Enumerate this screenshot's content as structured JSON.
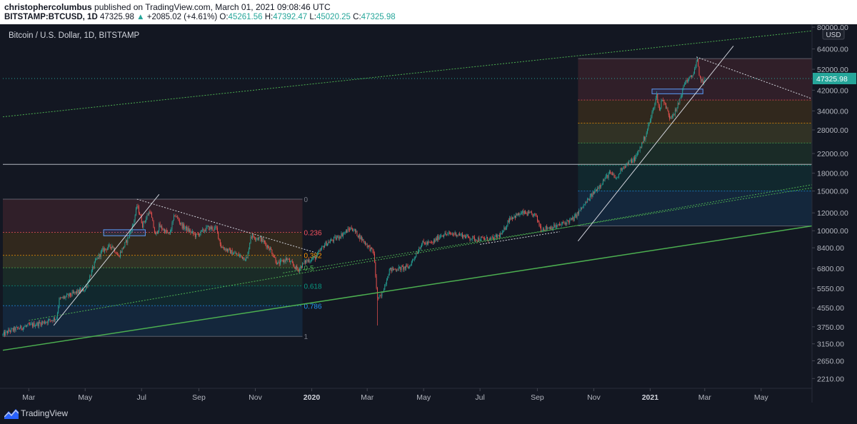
{
  "header": {
    "author": "christophercolumbus",
    "published_text": "published on TradingView.com, March 01, 2021 09:08:46 UTC",
    "symbol": "BITSTAMP:BTCUSD, 1D",
    "last": "47325.98",
    "change": "+2085.02 (+4.61%)",
    "open_label": "O:",
    "open": "45261.56",
    "high_label": "H:",
    "high": "47392.47",
    "low_label": "L:",
    "low": "45020.25",
    "close_label": "C:",
    "close": "47325.98"
  },
  "chart_data": {
    "type": "candlestick",
    "title": "Bitcoin / U.S. Dollar, 1D, BITSTAMP",
    "currency": "USD",
    "y_scale": "log",
    "ylim": [
      2000,
      80000
    ],
    "xlim": [
      "2019-02-01",
      "2021-06-25"
    ],
    "y_ticks": [
      80000,
      64000,
      52000,
      42000,
      34000,
      28000,
      22000,
      18000,
      15000,
      12000,
      10000,
      8400,
      6800,
      5550,
      4550,
      3750,
      3150,
      2650,
      2210
    ],
    "y_tick_labels": [
      "80000.00",
      "64000.00",
      "52000.00",
      "42000.00",
      "34000.00",
      "28000.00",
      "22000.00",
      "18000.00",
      "15000.00",
      "12000.00",
      "10000.00",
      "8400.00",
      "6800.00",
      "5550.00",
      "4550.00",
      "3750.00",
      "3150.00",
      "2650.00",
      "2210.00"
    ],
    "x_ticks": [
      {
        "date": "2019-03-01",
        "label": "Mar"
      },
      {
        "date": "2019-05-01",
        "label": "May"
      },
      {
        "date": "2019-07-01",
        "label": "Jul"
      },
      {
        "date": "2019-09-01",
        "label": "Sep"
      },
      {
        "date": "2019-11-01",
        "label": "Nov"
      },
      {
        "date": "2020-01-01",
        "label": "2020"
      },
      {
        "date": "2020-03-01",
        "label": "Mar"
      },
      {
        "date": "2020-05-01",
        "label": "May"
      },
      {
        "date": "2020-07-01",
        "label": "Jul"
      },
      {
        "date": "2020-09-01",
        "label": "Sep"
      },
      {
        "date": "2020-11-01",
        "label": "Nov"
      },
      {
        "date": "2021-01-01",
        "label": "2021"
      },
      {
        "date": "2021-03-01",
        "label": "Mar"
      },
      {
        "date": "2021-05-01",
        "label": "May"
      }
    ],
    "last_price_label": "47325.98",
    "price_path": [
      [
        "2019-02-01",
        3450
      ],
      [
        "2019-02-08",
        3600
      ],
      [
        "2019-02-24",
        3750
      ],
      [
        "2019-03-15",
        3900
      ],
      [
        "2019-03-31",
        4100
      ],
      [
        "2019-04-03",
        4950
      ],
      [
        "2019-04-20",
        5300
      ],
      [
        "2019-05-01",
        5500
      ],
      [
        "2019-05-12",
        7300
      ],
      [
        "2019-05-20",
        8200
      ],
      [
        "2019-05-30",
        8600
      ],
      [
        "2019-06-06",
        7700
      ],
      [
        "2019-06-16",
        9200
      ],
      [
        "2019-06-22",
        10700
      ],
      [
        "2019-06-26",
        12900
      ],
      [
        "2019-06-29",
        11900
      ],
      [
        "2019-07-02",
        10600
      ],
      [
        "2019-07-10",
        12300
      ],
      [
        "2019-07-16",
        9500
      ],
      [
        "2019-07-20",
        10500
      ],
      [
        "2019-07-31",
        9600
      ],
      [
        "2019-08-06",
        11800
      ],
      [
        "2019-08-14",
        10500
      ],
      [
        "2019-08-29",
        9500
      ],
      [
        "2019-09-10",
        10300
      ],
      [
        "2019-09-20",
        10200
      ],
      [
        "2019-09-25",
        8500
      ],
      [
        "2019-10-07",
        8000
      ],
      [
        "2019-10-23",
        7500
      ],
      [
        "2019-10-27",
        9500
      ],
      [
        "2019-11-07",
        9200
      ],
      [
        "2019-11-18",
        8200
      ],
      [
        "2019-11-25",
        7100
      ],
      [
        "2019-12-05",
        7500
      ],
      [
        "2019-12-17",
        6700
      ],
      [
        "2019-12-25",
        7300
      ],
      [
        "2020-01-05",
        7600
      ],
      [
        "2020-01-15",
        8700
      ],
      [
        "2020-01-30",
        9400
      ],
      [
        "2020-02-13",
        10300
      ],
      [
        "2020-02-26",
        9000
      ],
      [
        "2020-03-08",
        8000
      ],
      [
        "2020-03-12",
        5000
      ],
      [
        "2020-03-16",
        5100
      ],
      [
        "2020-03-25",
        6700
      ],
      [
        "2020-04-05",
        6800
      ],
      [
        "2020-04-15",
        6900
      ],
      [
        "2020-04-29",
        8800
      ],
      [
        "2020-05-10",
        8800
      ],
      [
        "2020-05-20",
        9600
      ],
      [
        "2020-06-05",
        9700
      ],
      [
        "2020-06-25",
        9200
      ],
      [
        "2020-07-15",
        9200
      ],
      [
        "2020-07-25",
        9700
      ],
      [
        "2020-08-02",
        11400
      ],
      [
        "2020-08-17",
        12000
      ],
      [
        "2020-08-30",
        11700
      ],
      [
        "2020-09-05",
        10200
      ],
      [
        "2020-09-23",
        10500
      ],
      [
        "2020-10-10",
        11300
      ],
      [
        "2020-10-21",
        12900
      ],
      [
        "2020-11-05",
        15500
      ],
      [
        "2020-11-18",
        18000
      ],
      [
        "2020-11-26",
        17000
      ],
      [
        "2020-12-01",
        19000
      ],
      [
        "2020-12-16",
        21000
      ],
      [
        "2020-12-27",
        26500
      ],
      [
        "2021-01-02",
        32000
      ],
      [
        "2021-01-08",
        40000
      ],
      [
        "2021-01-11",
        34000
      ],
      [
        "2021-01-14",
        39000
      ],
      [
        "2021-01-22",
        32000
      ],
      [
        "2021-01-29",
        34000
      ],
      [
        "2021-02-08",
        46000
      ],
      [
        "2021-02-15",
        48000
      ],
      [
        "2021-02-21",
        57000
      ],
      [
        "2021-02-23",
        48000
      ],
      [
        "2021-02-28",
        45500
      ],
      [
        "2021-03-01",
        47326
      ]
    ],
    "fib_retracements": [
      {
        "from": "2019-02-01",
        "to": "2019-12-22",
        "top": 13800,
        "bottom": 3400,
        "levels": [
          {
            "ratio": 0,
            "label": "0",
            "value": 13800
          },
          {
            "ratio": 0.236,
            "label": "0.236",
            "value": 9840
          },
          {
            "ratio": 0.382,
            "label": "0.382",
            "value": 7780
          },
          {
            "ratio": 0.5,
            "label": "0.5",
            "value": 6850
          },
          {
            "ratio": 0.618,
            "label": "0.618",
            "value": 5700
          },
          {
            "ratio": 0.786,
            "label": "0.786",
            "value": 4650
          },
          {
            "ratio": 1,
            "label": "1",
            "value": 3400
          }
        ]
      },
      {
        "from": "2020-10-15",
        "to": "2021-06-25",
        "top": 58000,
        "bottom": 10500,
        "levels": [
          {
            "ratio": 0,
            "value": 58000
          },
          {
            "ratio": 0.236,
            "value": 38000
          },
          {
            "ratio": 0.382,
            "value": 30000
          },
          {
            "ratio": 0.5,
            "value": 24500
          },
          {
            "ratio": 0.618,
            "value": 19500
          },
          {
            "ratio": 0.786,
            "value": 15000
          },
          {
            "ratio": 1,
            "value": 10500
          }
        ]
      }
    ],
    "trend_lines": [
      {
        "color": "#4caf50",
        "width": 1.5,
        "style": "solid",
        "from": [
          "2019-02-01",
          2950
        ],
        "to": [
          "2021-06-25",
          10500
        ]
      },
      {
        "color": "#4caf50",
        "width": 1,
        "style": "dotted",
        "from": [
          "2019-02-01",
          32000
        ],
        "to": [
          "2021-06-25",
          77000
        ]
      },
      {
        "color": "#4caf50",
        "width": 1,
        "style": "dotted",
        "from": [
          "2019-03-01",
          4000
        ],
        "to": [
          "2021-06-25",
          16000
        ]
      },
      {
        "color": "#4caf50",
        "width": 1,
        "style": "dotted",
        "from": [
          "2019-12-01",
          6500
        ],
        "to": [
          "2021-06-25",
          15500
        ]
      },
      {
        "color": "#d1d4dc",
        "width": 1,
        "style": "dotted",
        "from": [
          "2019-06-26",
          13800
        ],
        "to": [
          "2020-01-05",
          8000
        ]
      },
      {
        "color": "#d1d4dc",
        "width": 1,
        "style": "dotted",
        "from": [
          "2021-02-20",
          59000
        ],
        "to": [
          "2021-06-25",
          38500
        ]
      },
      {
        "color": "#d1d4dc",
        "width": 1,
        "style": "solid",
        "from": [
          "2019-03-28",
          3800
        ],
        "to": [
          "2019-07-20",
          14500
        ]
      },
      {
        "color": "#d1d4dc",
        "width": 1,
        "style": "solid",
        "from": [
          "2020-10-15",
          9000
        ],
        "to": [
          "2021-04-01",
          66000
        ]
      },
      {
        "color": "#d1d4dc",
        "width": 1,
        "style": "dotted",
        "from": [
          "2020-07-01",
          8700
        ],
        "to": [
          "2020-09-25",
          9900
        ]
      }
    ],
    "horizontal_lines": [
      {
        "value": 19700,
        "color": "#b2b5be",
        "style": "solid"
      },
      {
        "value": 47326,
        "color": "#26a69a",
        "style": "dotted"
      }
    ],
    "zones": [
      {
        "from": "2019-05-21",
        "to": "2019-07-05",
        "low": 9500,
        "high": 10100
      },
      {
        "from": "2021-01-03",
        "to": "2021-02-27",
        "low": 40500,
        "high": 42500
      }
    ]
  },
  "footer": {
    "brand": "TradingView"
  },
  "colors": {
    "background": "#131722",
    "up": "#26a69a",
    "down": "#ef5350",
    "text": "#b2b5be",
    "last_price_bg": "#26a69a"
  }
}
